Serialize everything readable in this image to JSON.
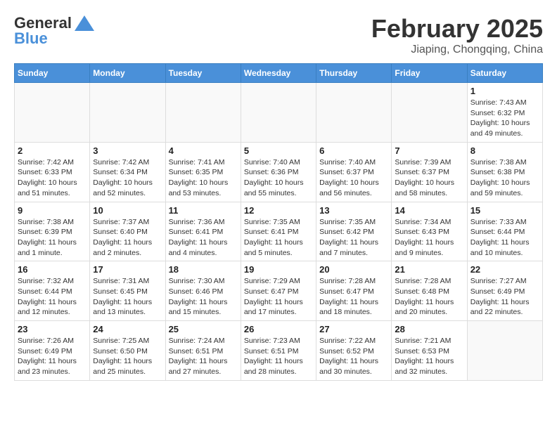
{
  "header": {
    "logo_general": "General",
    "logo_blue": "Blue",
    "month_title": "February 2025",
    "location": "Jiaping, Chongqing, China"
  },
  "days_of_week": [
    "Sunday",
    "Monday",
    "Tuesday",
    "Wednesday",
    "Thursday",
    "Friday",
    "Saturday"
  ],
  "weeks": [
    [
      {
        "day": "",
        "info": ""
      },
      {
        "day": "",
        "info": ""
      },
      {
        "day": "",
        "info": ""
      },
      {
        "day": "",
        "info": ""
      },
      {
        "day": "",
        "info": ""
      },
      {
        "day": "",
        "info": ""
      },
      {
        "day": "1",
        "info": "Sunrise: 7:43 AM\nSunset: 6:32 PM\nDaylight: 10 hours and 49 minutes."
      }
    ],
    [
      {
        "day": "2",
        "info": "Sunrise: 7:42 AM\nSunset: 6:33 PM\nDaylight: 10 hours and 51 minutes."
      },
      {
        "day": "3",
        "info": "Sunrise: 7:42 AM\nSunset: 6:34 PM\nDaylight: 10 hours and 52 minutes."
      },
      {
        "day": "4",
        "info": "Sunrise: 7:41 AM\nSunset: 6:35 PM\nDaylight: 10 hours and 53 minutes."
      },
      {
        "day": "5",
        "info": "Sunrise: 7:40 AM\nSunset: 6:36 PM\nDaylight: 10 hours and 55 minutes."
      },
      {
        "day": "6",
        "info": "Sunrise: 7:40 AM\nSunset: 6:37 PM\nDaylight: 10 hours and 56 minutes."
      },
      {
        "day": "7",
        "info": "Sunrise: 7:39 AM\nSunset: 6:37 PM\nDaylight: 10 hours and 58 minutes."
      },
      {
        "day": "8",
        "info": "Sunrise: 7:38 AM\nSunset: 6:38 PM\nDaylight: 10 hours and 59 minutes."
      }
    ],
    [
      {
        "day": "9",
        "info": "Sunrise: 7:38 AM\nSunset: 6:39 PM\nDaylight: 11 hours and 1 minute."
      },
      {
        "day": "10",
        "info": "Sunrise: 7:37 AM\nSunset: 6:40 PM\nDaylight: 11 hours and 2 minutes."
      },
      {
        "day": "11",
        "info": "Sunrise: 7:36 AM\nSunset: 6:41 PM\nDaylight: 11 hours and 4 minutes."
      },
      {
        "day": "12",
        "info": "Sunrise: 7:35 AM\nSunset: 6:41 PM\nDaylight: 11 hours and 5 minutes."
      },
      {
        "day": "13",
        "info": "Sunrise: 7:35 AM\nSunset: 6:42 PM\nDaylight: 11 hours and 7 minutes."
      },
      {
        "day": "14",
        "info": "Sunrise: 7:34 AM\nSunset: 6:43 PM\nDaylight: 11 hours and 9 minutes."
      },
      {
        "day": "15",
        "info": "Sunrise: 7:33 AM\nSunset: 6:44 PM\nDaylight: 11 hours and 10 minutes."
      }
    ],
    [
      {
        "day": "16",
        "info": "Sunrise: 7:32 AM\nSunset: 6:44 PM\nDaylight: 11 hours and 12 minutes."
      },
      {
        "day": "17",
        "info": "Sunrise: 7:31 AM\nSunset: 6:45 PM\nDaylight: 11 hours and 13 minutes."
      },
      {
        "day": "18",
        "info": "Sunrise: 7:30 AM\nSunset: 6:46 PM\nDaylight: 11 hours and 15 minutes."
      },
      {
        "day": "19",
        "info": "Sunrise: 7:29 AM\nSunset: 6:47 PM\nDaylight: 11 hours and 17 minutes."
      },
      {
        "day": "20",
        "info": "Sunrise: 7:28 AM\nSunset: 6:47 PM\nDaylight: 11 hours and 18 minutes."
      },
      {
        "day": "21",
        "info": "Sunrise: 7:28 AM\nSunset: 6:48 PM\nDaylight: 11 hours and 20 minutes."
      },
      {
        "day": "22",
        "info": "Sunrise: 7:27 AM\nSunset: 6:49 PM\nDaylight: 11 hours and 22 minutes."
      }
    ],
    [
      {
        "day": "23",
        "info": "Sunrise: 7:26 AM\nSunset: 6:49 PM\nDaylight: 11 hours and 23 minutes."
      },
      {
        "day": "24",
        "info": "Sunrise: 7:25 AM\nSunset: 6:50 PM\nDaylight: 11 hours and 25 minutes."
      },
      {
        "day": "25",
        "info": "Sunrise: 7:24 AM\nSunset: 6:51 PM\nDaylight: 11 hours and 27 minutes."
      },
      {
        "day": "26",
        "info": "Sunrise: 7:23 AM\nSunset: 6:51 PM\nDaylight: 11 hours and 28 minutes."
      },
      {
        "day": "27",
        "info": "Sunrise: 7:22 AM\nSunset: 6:52 PM\nDaylight: 11 hours and 30 minutes."
      },
      {
        "day": "28",
        "info": "Sunrise: 7:21 AM\nSunset: 6:53 PM\nDaylight: 11 hours and 32 minutes."
      },
      {
        "day": "",
        "info": ""
      }
    ]
  ]
}
